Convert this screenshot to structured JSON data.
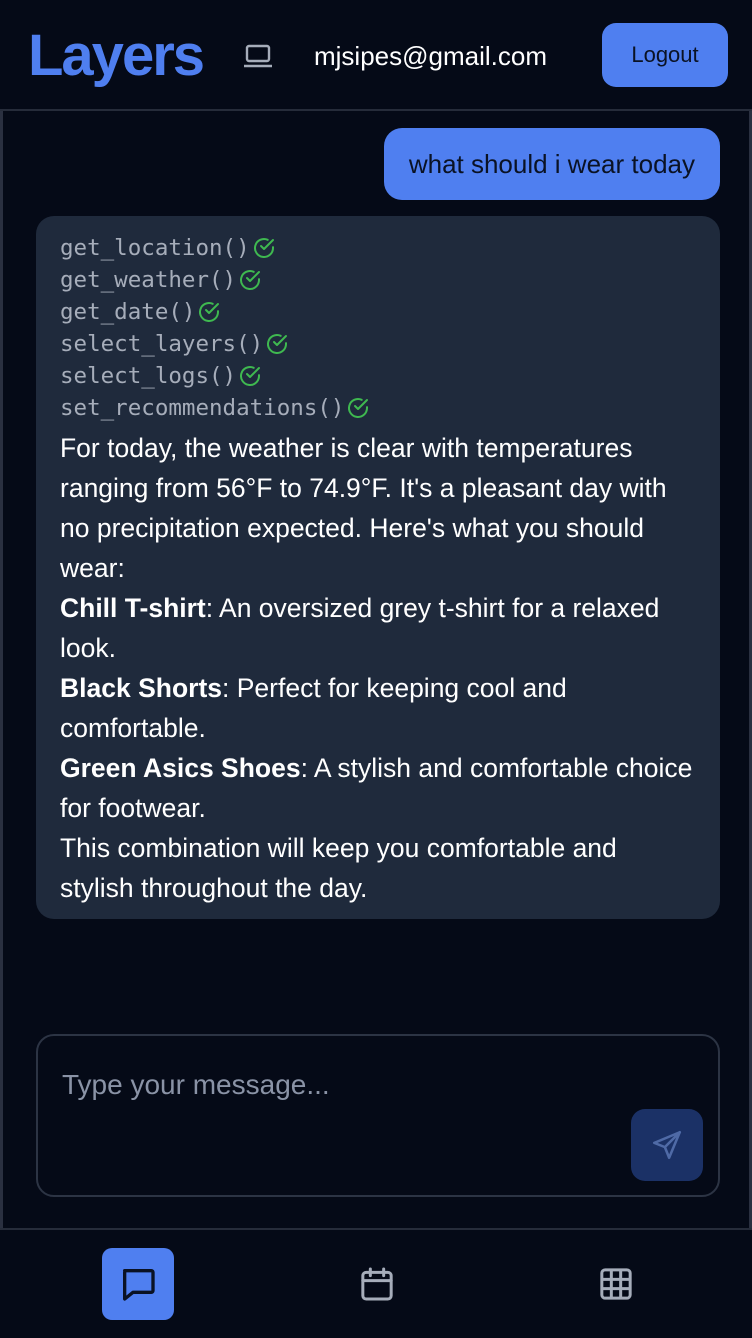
{
  "header": {
    "brand": "Layers",
    "device_icon": "laptop-icon",
    "email": "mjsipes@gmail.com",
    "logout_label": "Logout"
  },
  "conversation": {
    "user_message": "what should i wear today",
    "assistant": {
      "tool_calls": [
        "get_location()",
        "get_weather()",
        "get_date()",
        "select_layers()",
        "select_logs()",
        "set_recommendations()"
      ],
      "tool_status_icon": "check-circle-icon",
      "intro": "For today, the weather is clear with temperatures ranging from 56°F to 74.9°F. It's a pleasant day with no precipitation expected. Here's what you should wear:",
      "items": [
        {
          "name": "Chill T-shirt",
          "desc": ": An oversized grey t-shirt for a relaxed look."
        },
        {
          "name": "Black Shorts",
          "desc": ": Perfect for keeping cool and comfortable."
        },
        {
          "name": "Green Asics Shoes",
          "desc": ": A stylish and comfortable choice for footwear."
        }
      ],
      "outro": "This combination will keep you comfortable and stylish throughout the day."
    }
  },
  "composer": {
    "placeholder": "Type your message...",
    "send_icon": "send-icon"
  },
  "bottom_nav": {
    "items": [
      {
        "icon": "chat-icon",
        "active": true
      },
      {
        "icon": "calendar-icon",
        "active": false
      },
      {
        "icon": "grid-icon",
        "active": false
      }
    ]
  },
  "colors": {
    "background": "#050a17",
    "accent": "#4f7ff0",
    "bubble": "#1f2a3c",
    "check": "#3fb950"
  }
}
